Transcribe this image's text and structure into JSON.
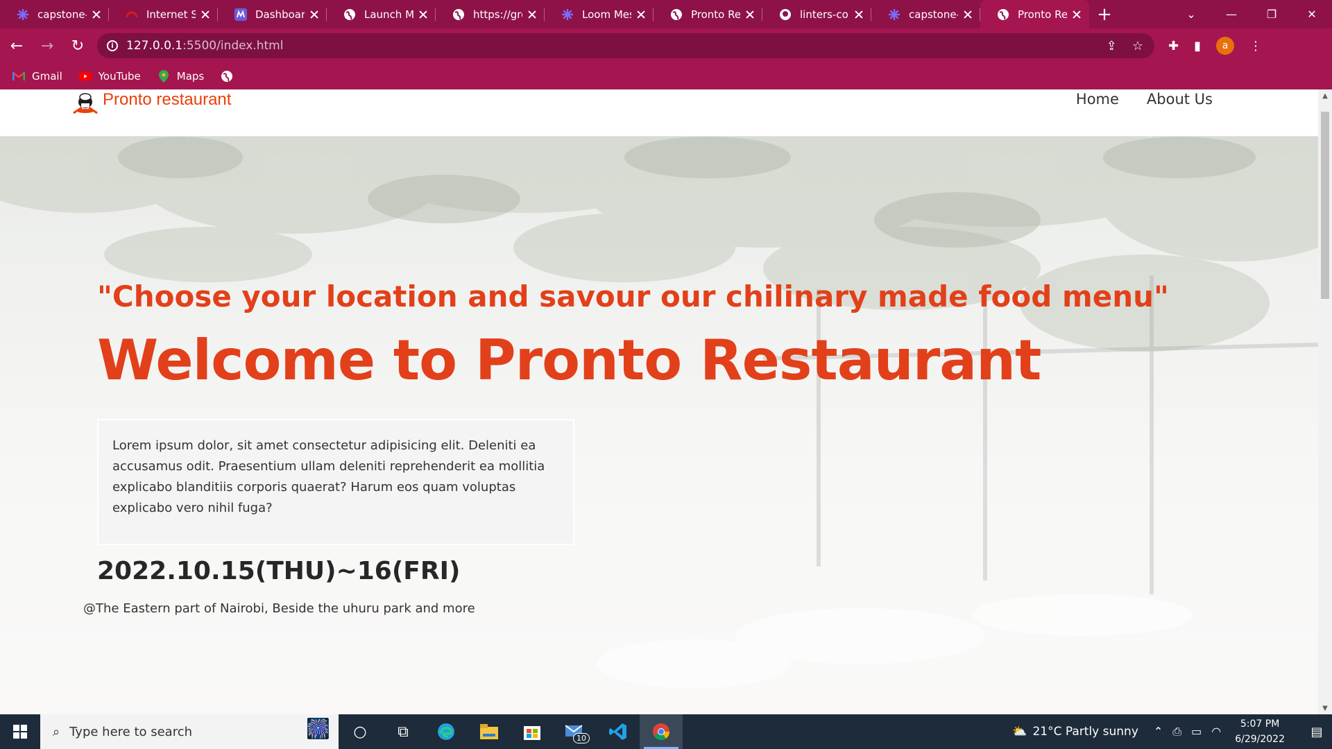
{
  "browser": {
    "tabs": [
      {
        "label": "capstone-o",
        "icon": "asterisk-icon",
        "color": "#7b6cff"
      },
      {
        "label": "Internet Sp",
        "icon": "speedometer-icon",
        "color": "#e01b1b"
      },
      {
        "label": "Dashboard",
        "icon": "dashboard-app-icon",
        "color": "#6e5bd8"
      },
      {
        "label": "Launch Me",
        "icon": "globe-icon",
        "color": "#ffffff"
      },
      {
        "label": "https://grov",
        "icon": "globe-icon",
        "color": "#ffffff"
      },
      {
        "label": "Loom Mess",
        "icon": "asterisk-icon",
        "color": "#7b6cff"
      },
      {
        "label": "Pronto Rest",
        "icon": "globe-icon",
        "color": "#ffffff"
      },
      {
        "label": "linters-conf",
        "icon": "github-icon",
        "color": "#ffffff"
      },
      {
        "label": "capstone-o",
        "icon": "asterisk-icon",
        "color": "#7b6cff"
      },
      {
        "label": "Pronto Rest",
        "icon": "globe-icon",
        "color": "#ffffff",
        "active": true
      }
    ],
    "url_host": "127.0.0.1",
    "url_rest": ":5500/index.html",
    "avatar_letter": "a",
    "bookmarks": [
      {
        "label": "Gmail",
        "icon": "gmail-icon"
      },
      {
        "label": "YouTube",
        "icon": "youtube-icon"
      },
      {
        "label": "Maps",
        "icon": "maps-icon"
      },
      {
        "label": "",
        "icon": "globe-icon"
      }
    ]
  },
  "site": {
    "brand": "Pronto restaurant",
    "nav": [
      "Home",
      "About Us"
    ],
    "tagline": "\"Choose your location and savour our chilinary made food menu\"",
    "headline": "Welcome to Pronto Restaurant",
    "description": "Lorem ipsum dolor, sit amet consectetur adipisicing elit. Deleniti ea accusamus odit. Praesentium ullam deleniti reprehenderit ea mollitia explicabo blanditiis corporis quaerat? Harum eos quam voluptas explicabo vero nihil fuga?",
    "event_date": "2022.10.15(THU)~16(FRI)",
    "event_location": "@The Eastern part of Nairobi, Beside the uhuru park and more",
    "accent_color": "#e2401a"
  },
  "taskbar": {
    "search_placeholder": "Type here to search",
    "mail_badge": "10",
    "weather": "21°C  Partly sunny",
    "time": "5:07 PM",
    "date": "6/29/2022"
  }
}
